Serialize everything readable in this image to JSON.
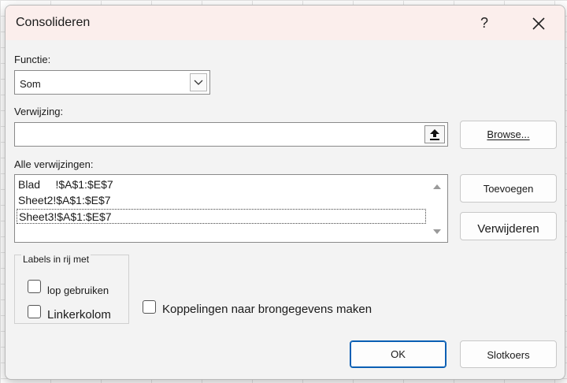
{
  "dialog": {
    "title": "Consolideren",
    "help_label": "?"
  },
  "function": {
    "label": "Functie:",
    "selected": "Som"
  },
  "reference": {
    "label": "Verwijzing:",
    "value": "",
    "browse_label": "Browse..."
  },
  "all_references": {
    "label": "Alle verwijzingen:",
    "items": [
      "Blad     !$A$1:$E$7",
      "Sheet2!$A$1:$E$7",
      "Sheet3!$A$1:$E$7"
    ],
    "selected_index": 2,
    "add_label": "Toevoegen",
    "delete_label": "Verwijderen"
  },
  "labels_group": {
    "title": "Labels in rij met",
    "top_row_label": "lop gebruiken",
    "left_column_label": "Linkerkolom"
  },
  "links_label": "Koppelingen naar brongegevens maken",
  "footer": {
    "ok_label": "OK",
    "close_label": "Slotkoers"
  },
  "colors": {
    "title_bar": "#fbeeec",
    "dialog_bg": "#f3f3f3",
    "primary_border": "#0a5fb4"
  }
}
